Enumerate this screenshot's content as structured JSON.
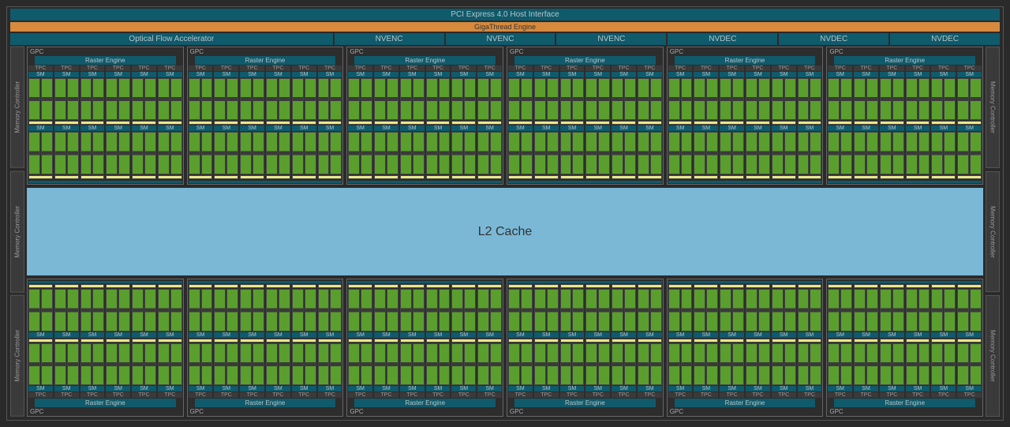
{
  "header": {
    "pci": "PCI Express 4.0 Host Interface",
    "gigathread": "GigaThread Engine",
    "ofa": "Optical Flow Accelerator",
    "codecs": [
      "NVENC",
      "NVENC",
      "NVENC",
      "NVDEC",
      "NVDEC",
      "NVDEC"
    ]
  },
  "labels": {
    "gpc": "GPC",
    "raster": "Raster Engine",
    "tpc": "TPC",
    "sm": "SM",
    "l2": "L2 Cache",
    "memctrl": "Memory Controller"
  },
  "layout": {
    "gpc_per_row": 6,
    "tpc_per_gpc": 6,
    "mem_ctrl_per_side": 3
  }
}
